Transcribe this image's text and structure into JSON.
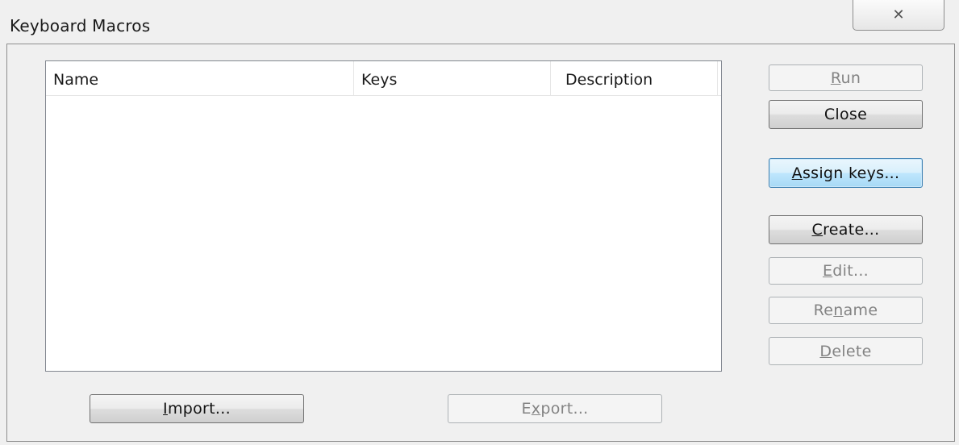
{
  "window": {
    "title": "Keyboard Macros",
    "close_glyph": "✕"
  },
  "list": {
    "columns": [
      "Name",
      "Keys",
      "Description"
    ],
    "rows": []
  },
  "buttons": {
    "run": {
      "prefix": "",
      "mnemonic": "R",
      "suffix": "un",
      "enabled": false
    },
    "close": {
      "prefix": "Close",
      "mnemonic": "",
      "suffix": "",
      "enabled": true
    },
    "assign_keys": {
      "prefix": "",
      "mnemonic": "A",
      "suffix": "ssign keys...",
      "enabled": true,
      "focused": true
    },
    "create": {
      "prefix": "",
      "mnemonic": "C",
      "suffix": "reate...",
      "enabled": true
    },
    "edit": {
      "prefix": "",
      "mnemonic": "E",
      "suffix": "dit...",
      "enabled": false
    },
    "rename": {
      "prefix": "Re",
      "mnemonic": "n",
      "suffix": "ame",
      "enabled": false
    },
    "delete": {
      "prefix": "",
      "mnemonic": "D",
      "suffix": "elete",
      "enabled": false
    },
    "import": {
      "prefix": "",
      "mnemonic": "I",
      "suffix": "mport...",
      "enabled": true
    },
    "export": {
      "prefix": "E",
      "mnemonic": "x",
      "suffix": "port...",
      "enabled": false
    }
  }
}
